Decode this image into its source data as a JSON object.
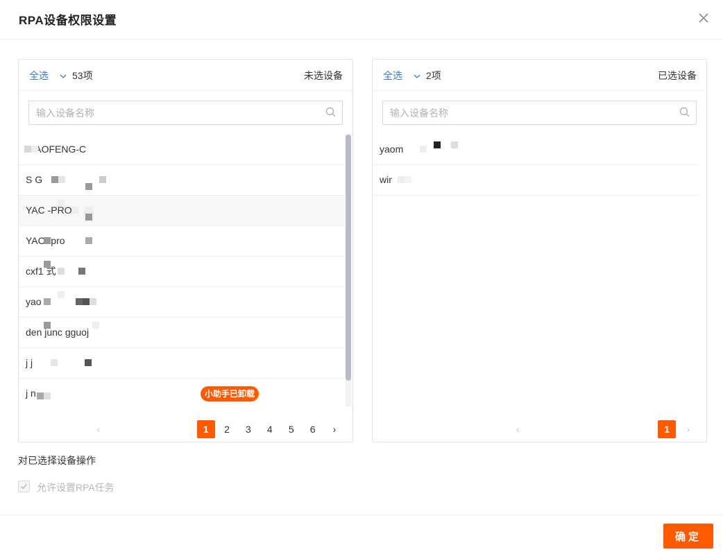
{
  "dialog": {
    "title": "RPA设备权限设置",
    "close_icon": "close-icon"
  },
  "left_panel": {
    "select_all": "全选",
    "count": "53项",
    "label": "未选设备",
    "search_placeholder": "输入设备名称",
    "items": [
      {
        "label": "XIAOFENG-C"
      },
      {
        "label": "S G"
      },
      {
        "label": "YAC -PRO1"
      },
      {
        "label": "YAC -pro"
      },
      {
        "label": "cxf1 式"
      },
      {
        "label": "yao"
      },
      {
        "label": "den junc gguoj"
      },
      {
        "label": "j j"
      },
      {
        "label": "j n",
        "badge": "小助手已卸载"
      }
    ],
    "pagination": {
      "pages": [
        "1",
        "2",
        "3",
        "4",
        "5",
        "6"
      ],
      "current": "1"
    }
  },
  "right_panel": {
    "select_all": "全选",
    "count": "2项",
    "label": "已选设备",
    "search_placeholder": "输入设备名称",
    "items": [
      {
        "label": "yaom"
      },
      {
        "label": "wir"
      }
    ],
    "pagination": {
      "pages": [
        "1"
      ],
      "current": "1"
    }
  },
  "operations": {
    "heading": "对已选择设备操作",
    "checkbox_label": "允许设置RPA任务",
    "checkbox_checked": true
  },
  "footer": {
    "confirm_label": "确定"
  },
  "colors": {
    "accent": "#ff5a00",
    "link": "#3a7bd5"
  }
}
